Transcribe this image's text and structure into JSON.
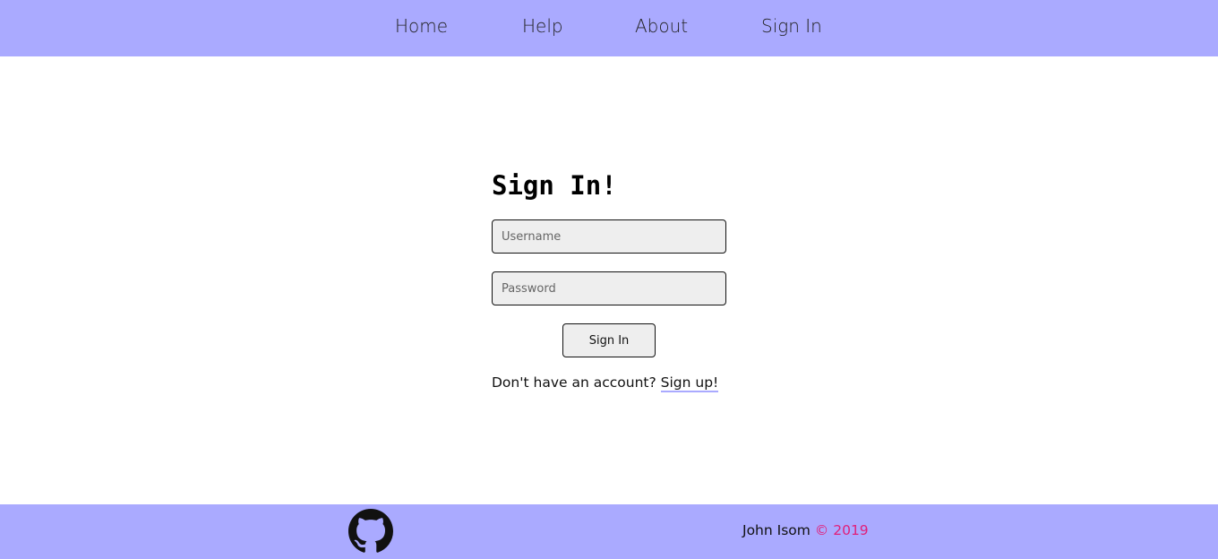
{
  "nav": {
    "items": [
      {
        "label": "Home"
      },
      {
        "label": "Help"
      },
      {
        "label": "About"
      },
      {
        "label": "Sign In"
      }
    ]
  },
  "form": {
    "title": "Sign In!",
    "username_placeholder": "Username",
    "password_placeholder": "Password",
    "submit_label": "Sign In",
    "signup_prompt": "Don't have an account?",
    "signup_link": "Sign up!"
  },
  "footer": {
    "github_icon": "github-icon",
    "author": "John Isom",
    "copyright": "© 2019"
  },
  "colors": {
    "nav_background": "#aaaaff",
    "footer_background": "#aaaaff",
    "input_background": "#eeeeee",
    "copyright_accent": "#e0207a"
  }
}
